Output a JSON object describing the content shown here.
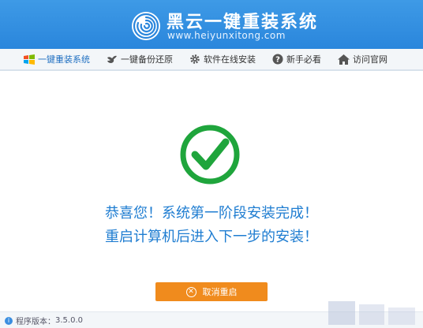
{
  "header": {
    "title": "黑云一键重装系统",
    "url": "www.heiyunxitong.com"
  },
  "nav": {
    "items": [
      {
        "label": "一键重装系统",
        "icon": "windows-icon"
      },
      {
        "label": "一键备份还原",
        "icon": "bird-icon"
      },
      {
        "label": "软件在线安装",
        "icon": "gear-icon"
      },
      {
        "label": "新手必看",
        "icon": "help-icon"
      },
      {
        "label": "访问官网",
        "icon": "home-icon"
      }
    ]
  },
  "main": {
    "line1": "恭喜您！系统第一阶段安装完成！",
    "line2": "重启计算机后进入下一步的安装！",
    "cancel_button": "取消重启"
  },
  "footer": {
    "version_label": "程序版本：",
    "version": "3.5.0.0"
  },
  "colors": {
    "header_blue": "#2a86dc",
    "success_green": "#1fa53c",
    "message_blue": "#1f7dd1",
    "button_orange": "#f08b1d"
  }
}
